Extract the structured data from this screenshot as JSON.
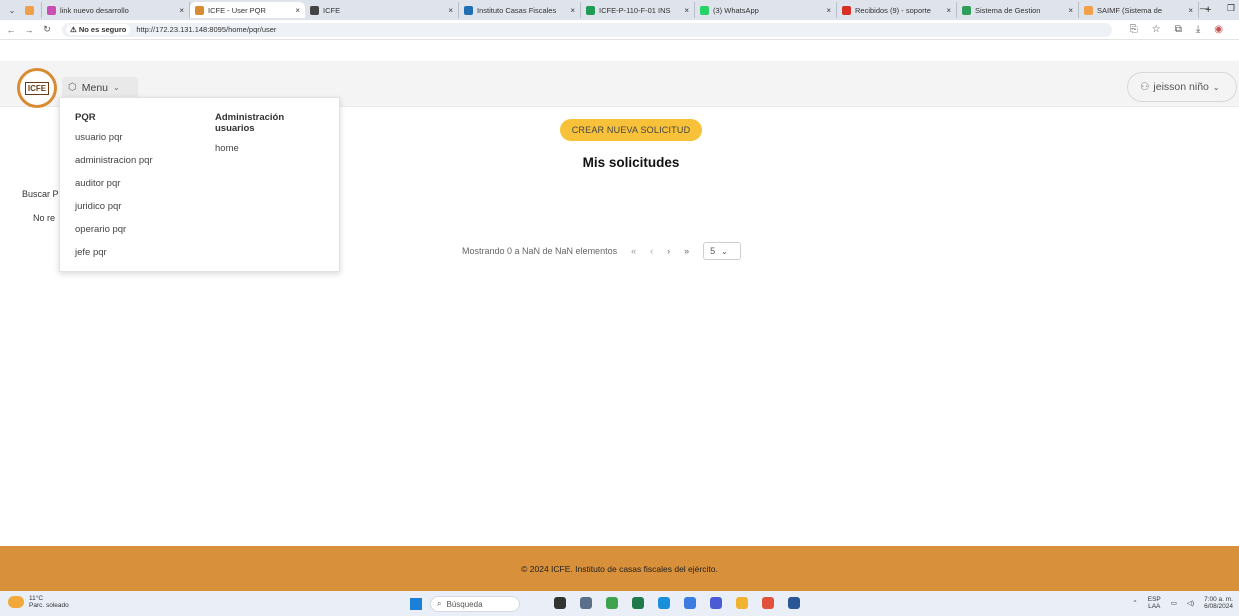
{
  "browser": {
    "tabs": [
      {
        "label": "",
        "favicon_color": "#f0a04b",
        "active": false,
        "width": 22
      },
      {
        "label": "link nuevo desarrollo",
        "favicon_color": "#c94fb0",
        "active": false,
        "width": 148
      },
      {
        "label": "ICFE - User PQR",
        "favicon_color": "#d98b33",
        "active": true,
        "width": 115
      },
      {
        "label": "ICFE",
        "favicon_color": "#444444",
        "active": false,
        "width": 154
      },
      {
        "label": "Instituto Casas Fiscales",
        "favicon_color": "#1f6fb2",
        "active": false,
        "width": 122
      },
      {
        "label": "ICFE-P-110-F-01 INS",
        "favicon_color": "#1f9d55",
        "active": false,
        "width": 114
      },
      {
        "label": "(3) WhatsApp",
        "favicon_color": "#25d366",
        "active": false,
        "width": 142
      },
      {
        "label": "Recibidos (9) - soporte",
        "favicon_color": "#d93025",
        "active": false,
        "width": 120
      },
      {
        "label": "Sistema de Gestion",
        "favicon_color": "#2e9e5b",
        "active": false,
        "width": 122
      },
      {
        "label": "SAIMF (Sistema de",
        "favicon_color": "#f0a04b",
        "active": false,
        "width": 120
      }
    ],
    "new_tab": "+",
    "security_label": "No es seguro",
    "url": "http://172.23.131.148:8095/home/pqr/user"
  },
  "header": {
    "logo_text": "ICFE",
    "menu_label": "Menu",
    "user_name": "jeisson niño"
  },
  "dropdown": {
    "left_heading": "PQR",
    "left_items": [
      "usuario pqr",
      "administracion pqr",
      "auditor pqr",
      "juridico pqr",
      "operario pqr",
      "jefe pqr"
    ],
    "right_heading_line1": "Administración",
    "right_heading_line2": "usuarios",
    "right_items": [
      "home"
    ]
  },
  "main": {
    "create_button": "CREAR NUEVA SOLICITUD",
    "title": "Mis solicitudes",
    "search_label": "Buscar P",
    "no_results": "No re"
  },
  "pagination": {
    "summary": "Mostrando 0 a NaN de NaN elementos",
    "first": "«",
    "prev": "‹",
    "next": "›",
    "last": "»",
    "page_size": "5"
  },
  "footer": {
    "text": "© 2024 ICFE. Instituto de casas fiscales del ejército."
  },
  "taskbar": {
    "temperature": "11°C",
    "weather": "Parc. soleado",
    "search_placeholder": "Búsqueda",
    "app_colors": [
      "#333333",
      "#5a6f8a",
      "#3fa34d",
      "#1e7a4a",
      "#1a8fd9",
      "#3c7be0",
      "#4b5bd6",
      "#f2b233",
      "#e0523c",
      "#2b5797"
    ],
    "language_line1": "ESP",
    "language_line2": "LAA",
    "time": "7:00 a. m.",
    "date": "6/08/2024"
  }
}
